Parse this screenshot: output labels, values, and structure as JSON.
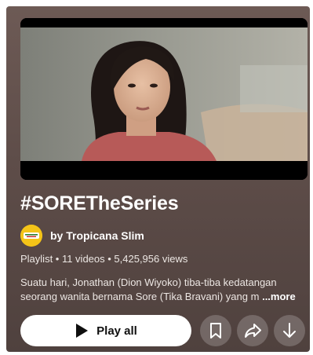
{
  "playlist": {
    "title": "#SORETheSeries",
    "channel_name": "by Tropicana Slim",
    "avatar_text": "TROPICANA SLIM",
    "meta": "Playlist • 11 videos • 5,425,956 views",
    "description_line1": "Suatu hari, Jonathan (Dion Wiyoko) tiba-tiba kedatangan",
    "description_line2": "seorang wanita bernama Sore (Tika Bravani) yang m",
    "more_label": "...more"
  },
  "actions": {
    "play_all_label": "Play all",
    "save_icon": "bookmark-icon",
    "share_icon": "share-icon",
    "download_icon": "download-icon"
  },
  "colors": {
    "background": "#5e4d49",
    "button_primary": "#ffffff",
    "button_secondary": "rgba(255,255,255,0.2)",
    "avatar": "#f4c418"
  }
}
